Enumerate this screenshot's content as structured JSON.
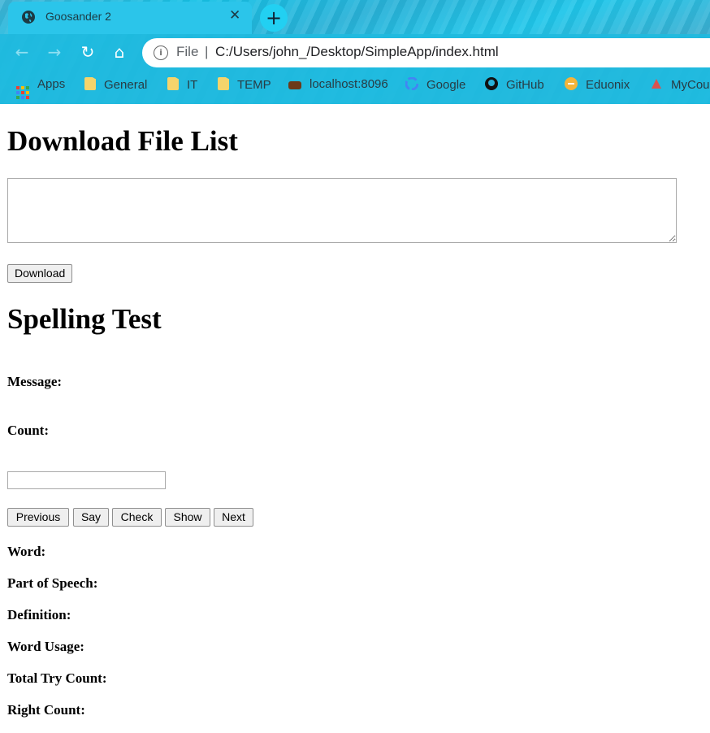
{
  "browser": {
    "tab_title": "Goosander 2",
    "tab_close": "✕",
    "new_tab": "+",
    "address_scheme": "File",
    "address_separator": "|",
    "address_url": "C:/Users/john_/Desktop/SimpleApp/index.html",
    "nav": {
      "back": "←",
      "forward": "→",
      "reload": "↻",
      "home": "⌂"
    },
    "bookmarks": [
      {
        "label": "Apps",
        "icon": "apps-grid-icon"
      },
      {
        "label": "General",
        "icon": "folder-icon"
      },
      {
        "label": "IT",
        "icon": "folder-icon"
      },
      {
        "label": "TEMP",
        "icon": "folder-icon"
      },
      {
        "label": "localhost:8096",
        "icon": "server-icon"
      },
      {
        "label": "Google",
        "icon": "google-icon"
      },
      {
        "label": "GitHub",
        "icon": "github-icon"
      },
      {
        "label": "Eduonix",
        "icon": "eduonix-icon"
      },
      {
        "label": "MyCou",
        "icon": "mycourses-icon"
      }
    ]
  },
  "download": {
    "heading": "Download File List",
    "textarea_value": "",
    "button_label": "Download"
  },
  "spelling": {
    "heading": "Spelling Test",
    "message_label": "Message:",
    "count_label": "Count:",
    "answer_value": "",
    "buttons": {
      "previous": "Previous",
      "say": "Say",
      "check": "Check",
      "show": "Show",
      "next": "Next"
    },
    "word_label": "Word:",
    "part_of_speech_label": "Part of Speech:",
    "definition_label": "Definition:",
    "word_usage_label": "Word Usage:",
    "total_try_count_label": "Total Try Count:",
    "right_count_label": "Right Count:"
  }
}
